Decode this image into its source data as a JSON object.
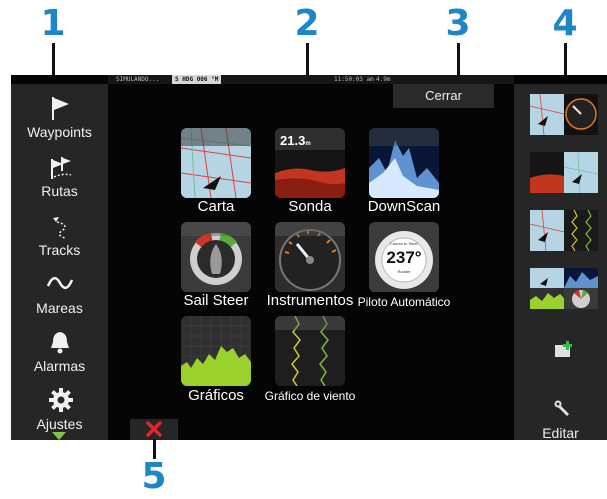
{
  "callouts": [
    "1",
    "2",
    "3",
    "4",
    "5"
  ],
  "status_bar": {
    "mode": "SIMULANDO...",
    "heading_prefix": "S HDG",
    "heading_value": "006",
    "heading_unit": "°M",
    "time": "11:50:03 am",
    "depth": "4.9m"
  },
  "sidebar": {
    "items": [
      {
        "label": "Waypoints",
        "icon": "flag-icon"
      },
      {
        "label": "Rutas",
        "icon": "route-flags-icon"
      },
      {
        "label": "Tracks",
        "icon": "track-trail-icon"
      },
      {
        "label": "Mareas",
        "icon": "wave-icon"
      },
      {
        "label": "Alarmas",
        "icon": "bell-icon"
      },
      {
        "label": "Ajustes",
        "icon": "gear-icon"
      }
    ]
  },
  "close_button": "Cerrar",
  "apps": [
    {
      "label": "Carta",
      "icon": "chart-plotter-icon"
    },
    {
      "label": "Sonda",
      "icon": "sonar-icon",
      "value": "21.3",
      "unit": "m"
    },
    {
      "label": "DownScan",
      "icon": "downscan-icon"
    },
    {
      "label": "Sail Steer",
      "icon": "sail-steer-icon"
    },
    {
      "label": "Instrumentos",
      "icon": "instruments-gauge-icon"
    },
    {
      "label": "Piloto Automático",
      "icon": "autopilot-icon",
      "value": "237°",
      "top_text": "Course to Steer",
      "bottom_text": "Rudder"
    },
    {
      "label": "Gráficos",
      "icon": "graph-icon"
    },
    {
      "label": "Gráfico de viento",
      "icon": "wind-graph-icon"
    }
  ],
  "favorites": {
    "thumbnails": [
      "chart-gauge-layout",
      "sonar-chart-layout",
      "chart-wind-graph-layout",
      "multi-panel-layout"
    ],
    "add_icon": "add-page-icon",
    "edit_icon": "wrench-icon",
    "edit_label": "Editar"
  },
  "close_x_icon": "close-x-icon",
  "colors": {
    "callout": "#1e86c6",
    "panel": "#262626",
    "screen": "#050505",
    "close_x": "#e2242b"
  }
}
